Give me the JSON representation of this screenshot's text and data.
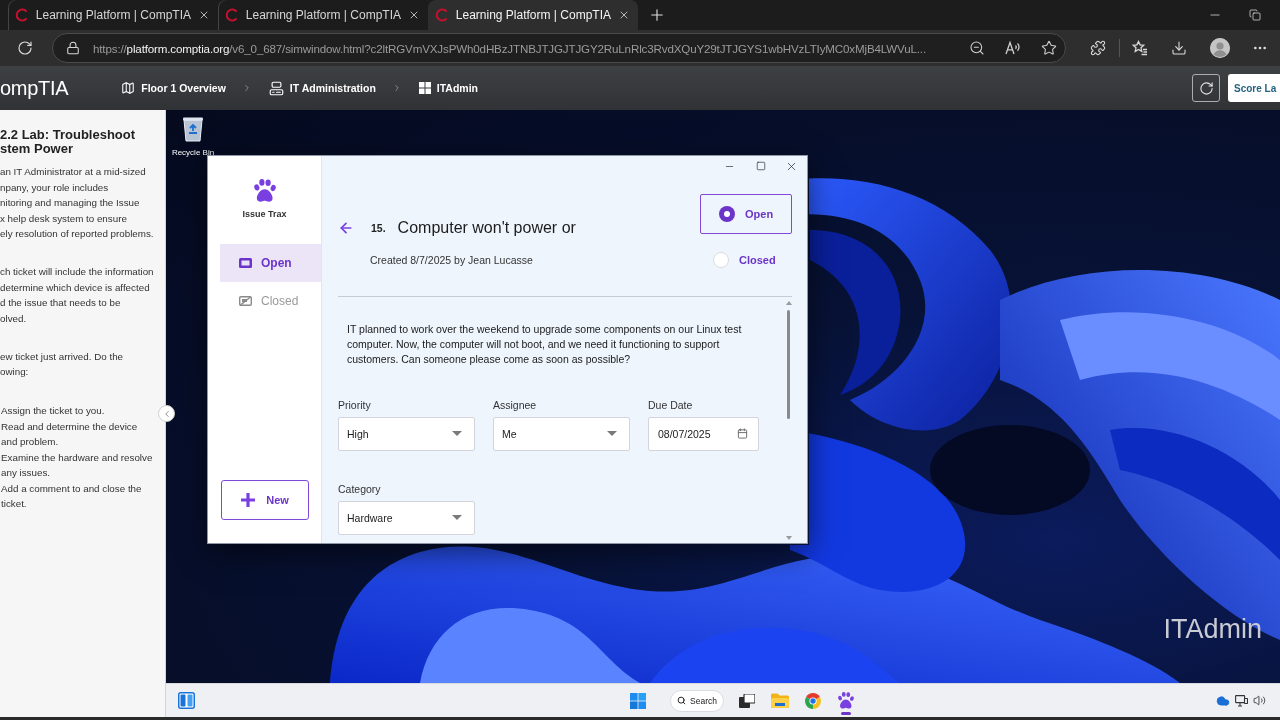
{
  "browser": {
    "tabs": [
      {
        "title": "Learning Platform | CompTIA",
        "selected": false
      },
      {
        "title": "Learning Platform | CompTIA",
        "selected": false
      },
      {
        "title": "Learning Platform | CompTIA",
        "selected": true
      }
    ],
    "url": [
      {
        "text": "https://",
        "emphasis": false
      },
      {
        "text": "platform.comptia.org",
        "emphasis": true
      },
      {
        "text": "/v6_0_687/simwindow.html?c2ltRGVmVXJsPWh0dHBzJTNBJTJGJTJGY2RuLnRlc3RvdXQuY29tJTJGYS1wbHVzLTIyMC0xMjB4LWVuL...",
        "emphasis": false
      }
    ]
  },
  "lab_header": {
    "logo": "ompTIA",
    "breadcrumbs": [
      {
        "label": "Floor 1 Overview",
        "kind": "map"
      },
      {
        "label": "IT Administration",
        "kind": "computer"
      },
      {
        "label": "ITAdmin",
        "kind": "windows"
      }
    ],
    "score_button": "Score La"
  },
  "instructions": {
    "title": "2.2 Lab: Troubleshoot\nstem Power",
    "paragraphs": [
      "an IT Administrator at a mid-sized\nnpany, your role includes\nnitoring and managing the Issue\nx help desk system to ensure\nely resolution of reported problems.",
      "ch ticket will include the information\ndetermine which device is affected\nd the issue that needs to be\nolved.",
      "ew ticket just arrived. Do the\nowing:"
    ],
    "steps": [
      "Assign the ticket to you.",
      "Read and determine the device\nand problem.",
      "Examine the hardware and resolve\nany issues.",
      "Add a comment to and close the\nticket."
    ]
  },
  "desktop": {
    "icons": [
      {
        "label": "Recycle Bin"
      }
    ],
    "computer_name": "ITAdmin"
  },
  "issue_window": {
    "app_name": "Issue Trax",
    "nav": [
      {
        "label": "Open",
        "kind": "open",
        "selected": true
      },
      {
        "label": "Closed",
        "kind": "closed",
        "selected": false
      }
    ],
    "new_button": "New",
    "ticket": {
      "number": "15.",
      "title": "Computer won't power or",
      "created": "Created 8/7/2025 by Jean Lucasse",
      "status_options": [
        {
          "label": "Open",
          "selected": true
        },
        {
          "label": "Closed",
          "selected": false
        }
      ],
      "description": "IT planned to work over the weekend to upgrade some components on our Linux test computer. Now, the computer will not boot, and we need it functioning to support customers. Can someone please come as soon as possible?",
      "fields": [
        {
          "label": "Priority",
          "kind": "select",
          "value": "High"
        },
        {
          "label": "Assignee",
          "kind": "select",
          "value": "Me"
        },
        {
          "label": "Due Date",
          "kind": "date",
          "value": "08/07/2025"
        },
        {
          "label": "Category",
          "kind": "select",
          "value": "Hardware"
        }
      ]
    }
  },
  "taskbar": {
    "search": "Search",
    "apps": [
      {
        "kind": "task-view",
        "active": false
      },
      {
        "kind": "folder",
        "active": false
      },
      {
        "kind": "browser",
        "active": false
      },
      {
        "kind": "paw",
        "active": true
      }
    ]
  }
}
